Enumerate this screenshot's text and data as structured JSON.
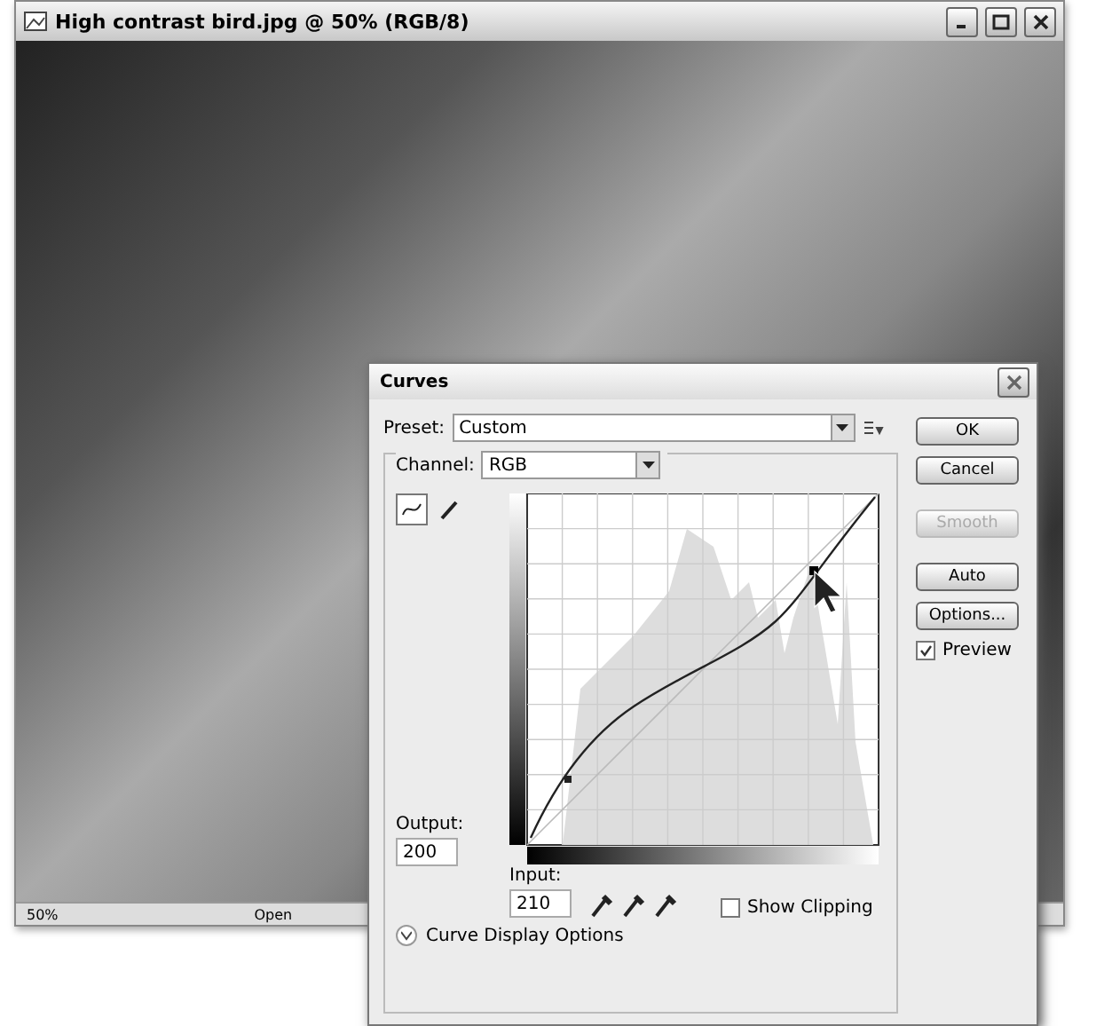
{
  "document_window": {
    "title": "High contrast bird.jpg @ 50% (RGB/8)",
    "status_bar": {
      "zoom": "50%",
      "info": "Open"
    }
  },
  "curves_dialog": {
    "title": "Curves",
    "preset": {
      "label": "Preset:",
      "value": "Custom"
    },
    "channel": {
      "label": "Channel:",
      "value": "RGB"
    },
    "tools": [
      {
        "kind": "curve",
        "selected": true
      },
      {
        "kind": "pencil",
        "selected": false
      }
    ],
    "output": {
      "label": "Output:",
      "value": "200"
    },
    "input": {
      "label": "Input:",
      "value": "210"
    },
    "buttons": [
      {
        "label": "OK",
        "disabled": false
      },
      {
        "label": "Cancel",
        "disabled": false
      },
      {
        "label": "Smooth",
        "disabled": true
      },
      {
        "label": "Auto",
        "disabled": false
      },
      {
        "label": "Options...",
        "disabled": false
      }
    ],
    "preview": {
      "label": "Preview",
      "checked": true
    },
    "show_clipping": {
      "label": "Show Clipping",
      "checked": false
    },
    "display_options": {
      "label": "Curve Display Options",
      "expanded": false
    }
  }
}
